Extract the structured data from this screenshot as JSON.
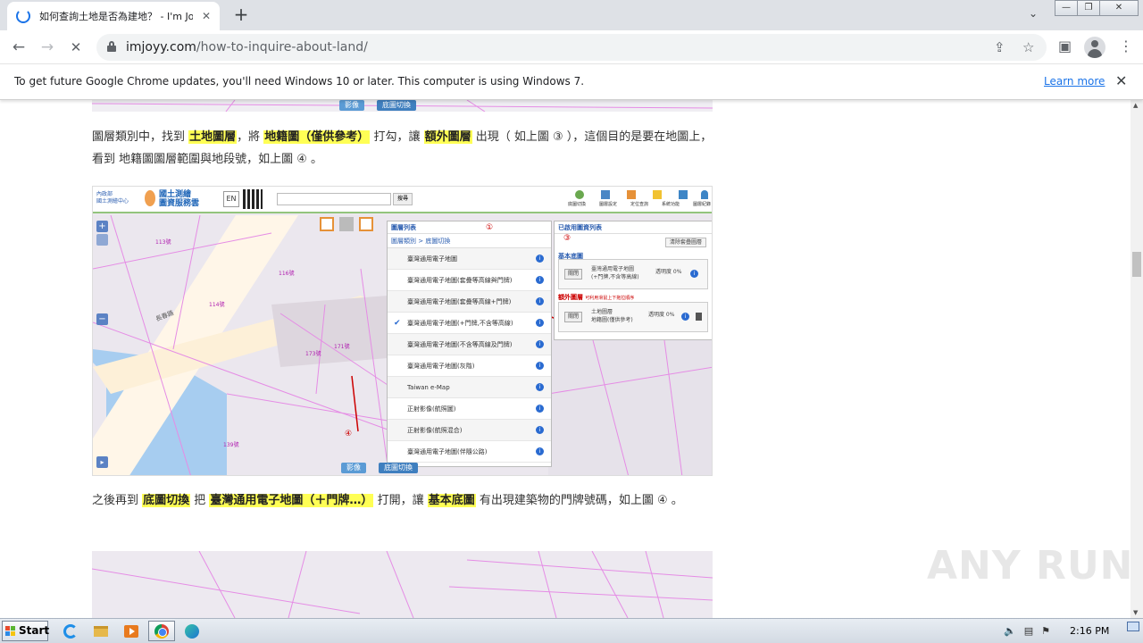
{
  "tab": {
    "title": "如何查詢土地是否為建地？ - I'm Joyy",
    "close": "✕",
    "new_tab": "+"
  },
  "window": {
    "tab_search": "⌄",
    "minimize": "—",
    "restore": "❐",
    "close": "✕"
  },
  "toolbar": {
    "back": "←",
    "forward": "→",
    "reload": "✕",
    "url_host": "imjoyy.com",
    "url_path": "/how-to-inquire-about-land/",
    "share": "⇪",
    "bookmark": "☆",
    "sidebar": "▣",
    "menu": "⋮"
  },
  "infobar": {
    "message": "To get future Google Chrome updates, you'll need Windows 10 or later. This computer is using Windows 7.",
    "learn_more": "Learn more",
    "close": "✕"
  },
  "article": {
    "para1_a": "圖層類別中，找到 ",
    "para1_hl1": "土地圖層",
    "para1_b": "，將 ",
    "para1_hl2": "地籍圖（僅供參考）",
    "para1_c": " 打勾，讓 ",
    "para1_hl3": "額外圖層",
    "para1_d": " 出現（ 如上圖 ③ ），這個目的是要在地圖上，看到 地籍圖圖層範圍與地段號，如上圖 ④ 。",
    "para2_a": "之後再到 ",
    "para2_hl1": "底圖切換",
    "para2_b": " 把 ",
    "para2_hl2": "臺灣通用電子地圖（＋門牌…）",
    "para2_c": " 打開，讓 ",
    "para2_hl3": "基本底圖",
    "para2_d": " 有出現建築物的門牌號碼，如上圖 ④ 。"
  },
  "figure": {
    "header_org": "內政部\n國土測繪中心",
    "header_brand": "國土測繪\n圖資服務雲",
    "header_lang": "EN",
    "header_search_btn": "搜尋",
    "header_tools": [
      "底圖切換",
      "圖層設定",
      "定位查詢",
      "系統功能",
      "圖層紀錄"
    ],
    "layer_panel_title": "圖層列表",
    "layer_panel_crumb": "圖層類別 > 底圖切換",
    "layers": [
      "臺灣通用電子地圖",
      "臺灣通用電子地圖(套疊等高線與門牌)",
      "臺灣通用電子地圖(套疊等高線+門牌)",
      "臺灣通用電子地圖(+門牌,不含等高線)",
      "臺灣通用電子地圖(不含等高線及門牌)",
      "臺灣通用電子地圖(灰階)",
      "Taiwan e-Map",
      "正射影像(航照圖)",
      "正射影像(航照混合)",
      "臺灣通用電子地圖(伴隨公路)"
    ],
    "selected_panel_title": "已啟用圖資列表",
    "clear_btn": "清除套疊圖層",
    "base_label": "基本底圖",
    "base_layer": "臺灣通用電子地圖\n(+門牌,不含等高線)",
    "base_opacity": "透明度 0%",
    "extra_label": "額外圖層",
    "extra_note": "可利用滑鼠上下拖拉順序",
    "extra_layer": "土地圖層\n地籍圖(僅供參考)",
    "extra_opacity": "透明度 0%",
    "toggle_btn": "關閉",
    "btn_image": "影像",
    "btn_base": "底圖切換",
    "markers": [
      "①",
      "②",
      "③",
      "④"
    ],
    "road_label": "長春路",
    "parcel_labels": [
      "173號",
      "171號",
      "116號",
      "114號",
      "113號",
      "139號"
    ]
  },
  "taskbar": {
    "start": "Start",
    "clock": "2:16 PM"
  },
  "watermark": "ANY RUN"
}
